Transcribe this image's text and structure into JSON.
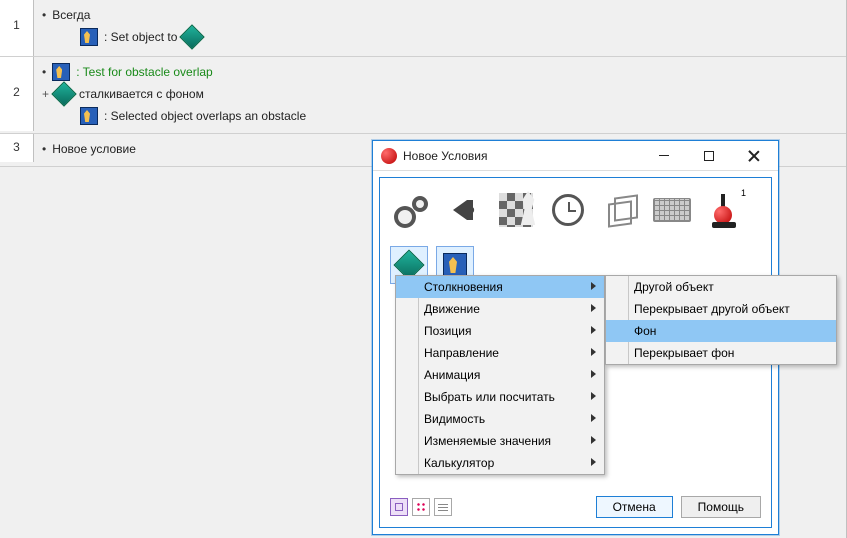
{
  "events": {
    "row1": {
      "num": "1",
      "condition": "Всегда",
      "action": ": Set object to"
    },
    "row2": {
      "num": "2",
      "cond_a": ": Test for obstacle overlap",
      "cond_b": "сталкивается с фоном",
      "action": ": Selected object overlaps an obstacle"
    },
    "row3": {
      "num": "3",
      "condition": "Новое условие"
    }
  },
  "dialog": {
    "title": "Новое Условия",
    "buttons": {
      "cancel": "Отмена",
      "help": "Помощь"
    },
    "joystick_badge": "1"
  },
  "menu_main": [
    "Столкновения",
    "Движение",
    "Позиция",
    "Направление",
    "Анимация",
    "Выбрать или посчитать",
    "Видимость",
    "Изменяемые значения",
    "Калькулятор"
  ],
  "menu_sub": [
    "Другой объект",
    "Перекрывает другой объект",
    "Фон",
    "Перекрывает фон"
  ]
}
